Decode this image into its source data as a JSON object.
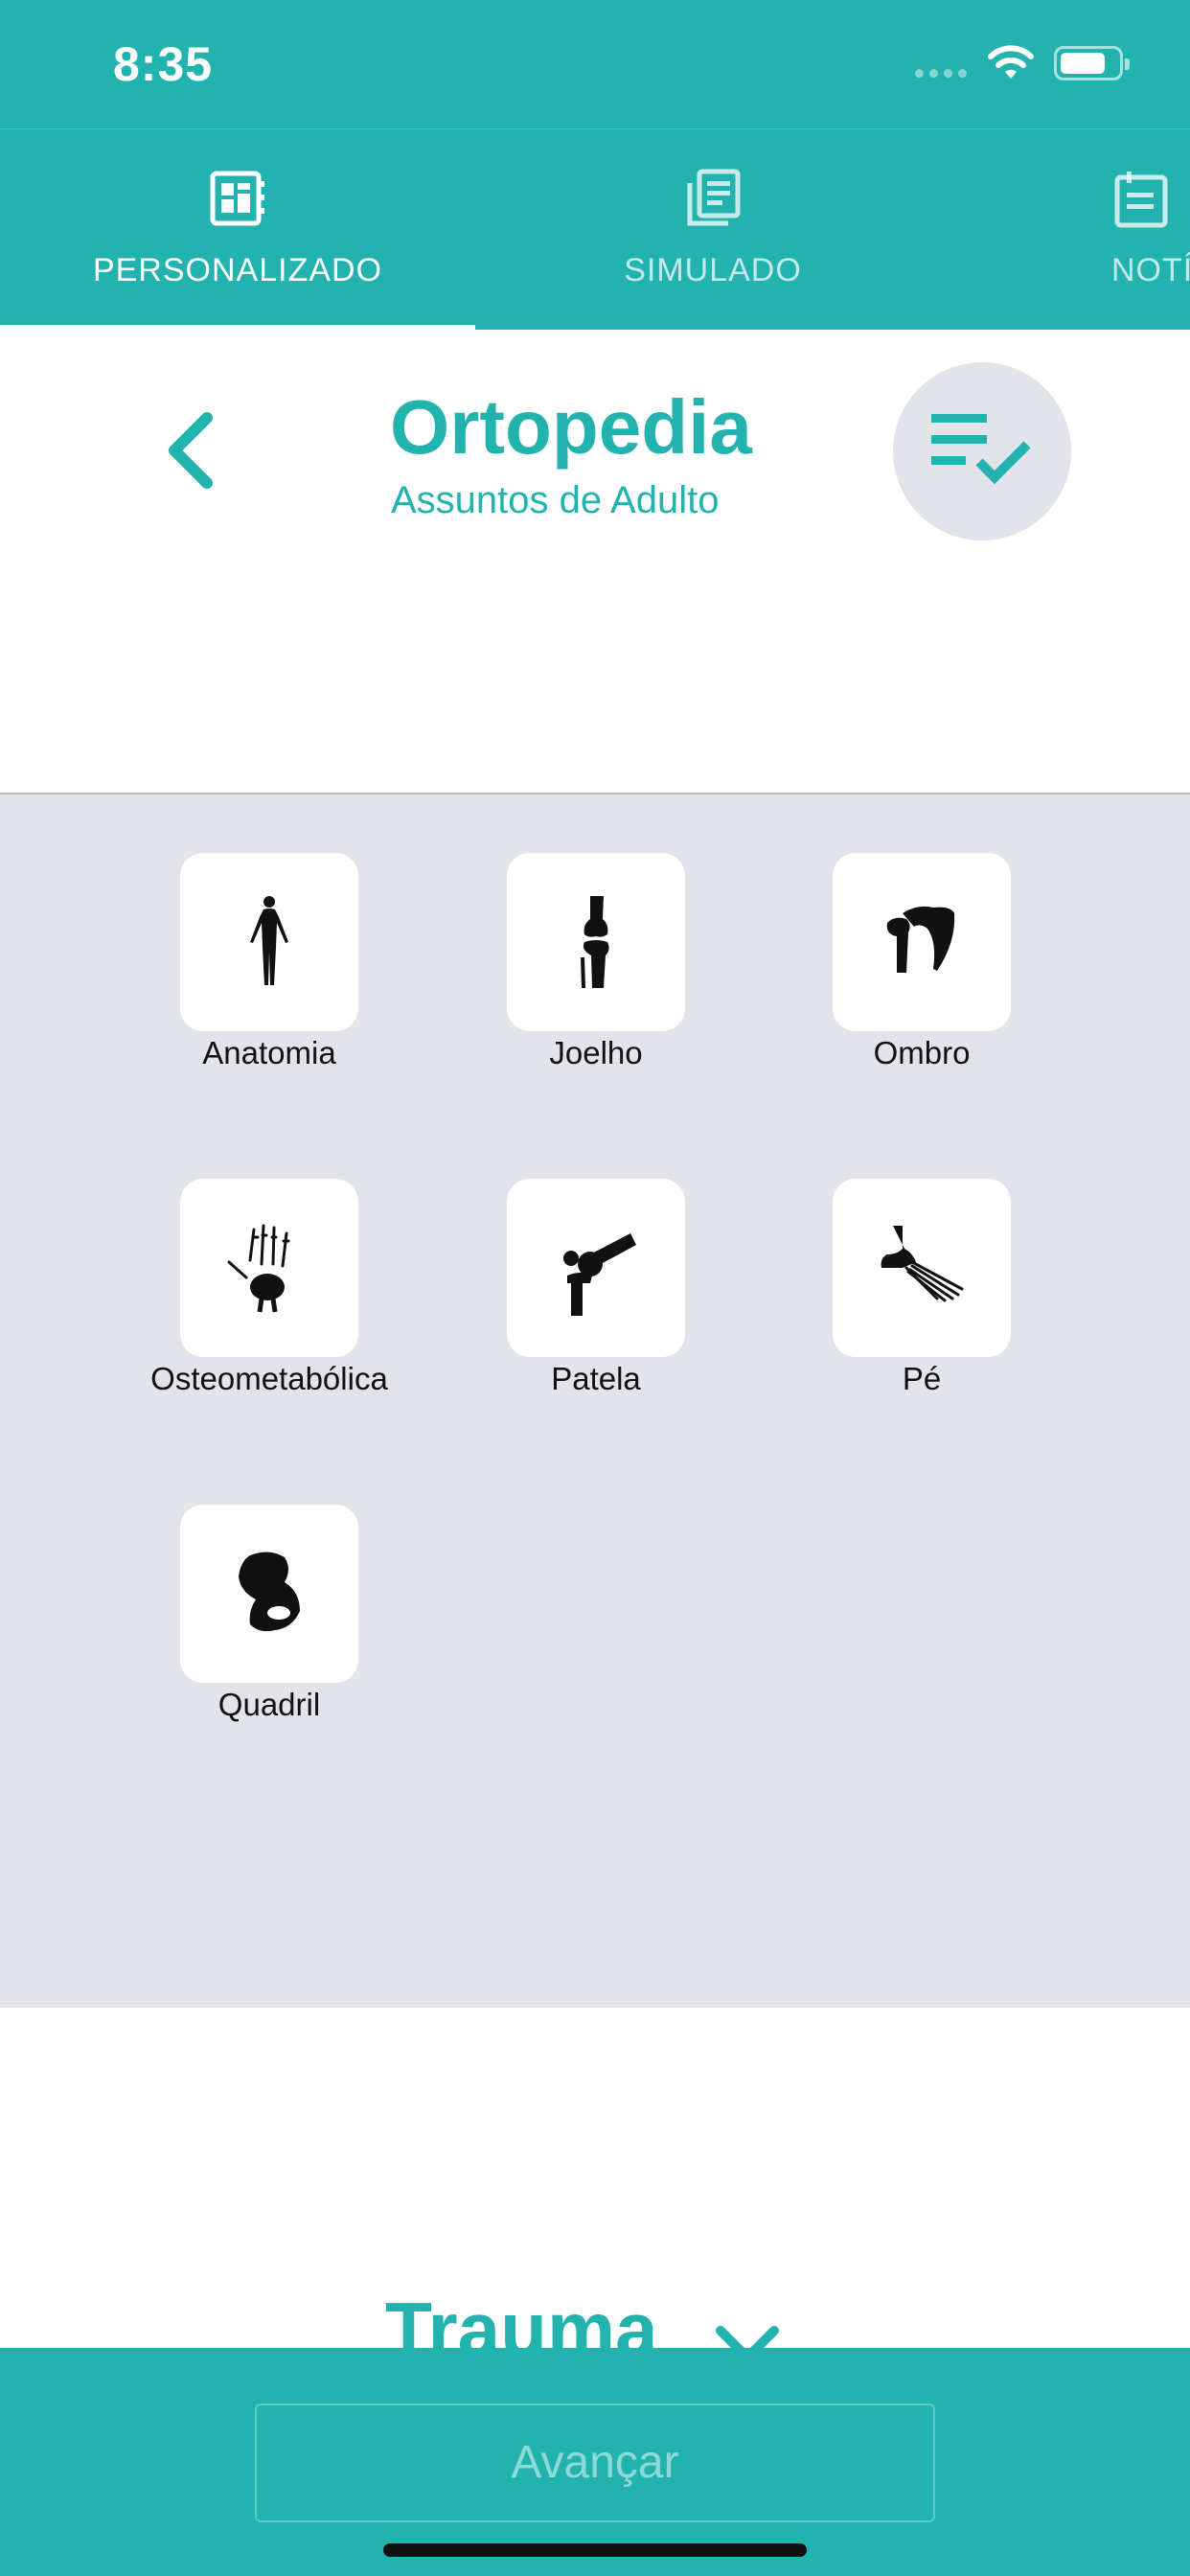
{
  "status": {
    "time": "8:35"
  },
  "tabs": [
    {
      "label": "PERSONALIZADO",
      "icon": "dashboard-icon",
      "selected": true
    },
    {
      "label": "SIMULADO",
      "icon": "document-stack-icon",
      "selected": false
    },
    {
      "label": "NOTÍ",
      "icon": "calendar-icon",
      "selected": false
    }
  ],
  "header": {
    "title": "Ortopedia",
    "subtitle": "Assuntos de Adulto"
  },
  "topics": [
    {
      "label": "Anatomia",
      "icon": "human-body-icon"
    },
    {
      "label": "Joelho",
      "icon": "knee-icon"
    },
    {
      "label": "Ombro",
      "icon": "shoulder-icon"
    },
    {
      "label": "Osteometabólica",
      "icon": "hand-skeleton-icon"
    },
    {
      "label": "Patela",
      "icon": "patella-icon"
    },
    {
      "label": "Pé",
      "icon": "foot-skeleton-icon"
    },
    {
      "label": "Quadril",
      "icon": "hip-icon"
    }
  ],
  "section": {
    "title": "Trauma"
  },
  "footer": {
    "advance_label": "Avançar"
  },
  "colors": {
    "accent": "#23b3ae",
    "grid_bg": "#e3e3ea",
    "card_bg": "#ffffff"
  }
}
